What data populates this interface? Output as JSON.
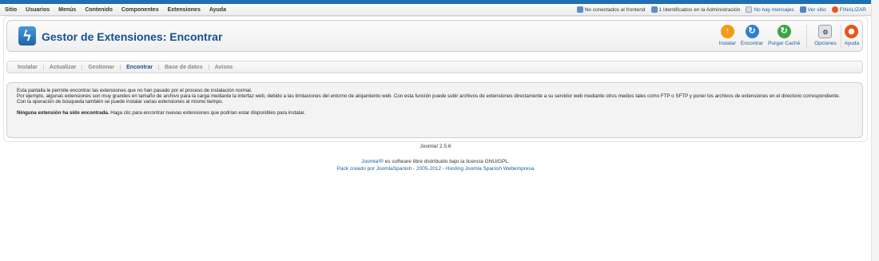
{
  "menu": {
    "items": [
      "Sitio",
      "Usuarios",
      "Menús",
      "Contenido",
      "Componentes",
      "Extensiones",
      "Ayuda"
    ]
  },
  "status": {
    "frontend": "No conectados al frontend",
    "admin": "1 Identificados en la Administración",
    "messages": "No hay mensajes",
    "view_site": "Ver sitio",
    "logout": "FINALIZAR"
  },
  "header": {
    "title": "Gestor de Extensiones: Encontrar",
    "toolbar": {
      "install": "Instalar",
      "find": "Encontrar",
      "purge": "Purgar Caché",
      "options": "Opciones",
      "help": "Ayuda"
    }
  },
  "subnav": {
    "tabs": [
      "Instalar",
      "Actualizar",
      "Gestionar",
      "Encontrar",
      "Base de datos",
      "Avisos"
    ],
    "active": "Encontrar"
  },
  "message": {
    "line1": "Esta pantalla le permite encontrar las extensiones que no han pasado por el proceso de instalación normal.",
    "line2": "Por ejemplo, algunas extensiones son muy grandes en tamaño de archivo para la carga mediante la interfaz web, debido a las limitaciones del entorno de alojamiento web. Con esta función puede subir archivos de extensiones directamente a su servidor web mediante otros medios tales como FTP o SFTP y poner los archivos de extensiones en el directorio correspondiente.",
    "line3": "Con la operación de búsqueda también se puede instalar varias extensiones al mismo tiempo.",
    "none_bold": "Ninguna extensión ha sido encontrada.",
    "none_rest": " Haga clic para encontrar nuevas extensiones que podrían estar disponibles para instalar."
  },
  "footer": {
    "version": "Joomla! 2.5.6",
    "license_link": "Joomla!®",
    "license_rest": " es software libre distribuido bajo la licencia GNU/GPL.",
    "pack": "Pack creado por JoomlaSpanish - 2005-2012 - Hosting Joomla Spanish Webempresa"
  },
  "colors": {
    "accent": "#1f6fb2",
    "title": "#15508e",
    "link": "#1a5fa0",
    "install_icon": "#f39c12",
    "find_icon": "#2f7fd1",
    "purge_icon": "#3aa544",
    "logout_icon": "#e8551c"
  }
}
